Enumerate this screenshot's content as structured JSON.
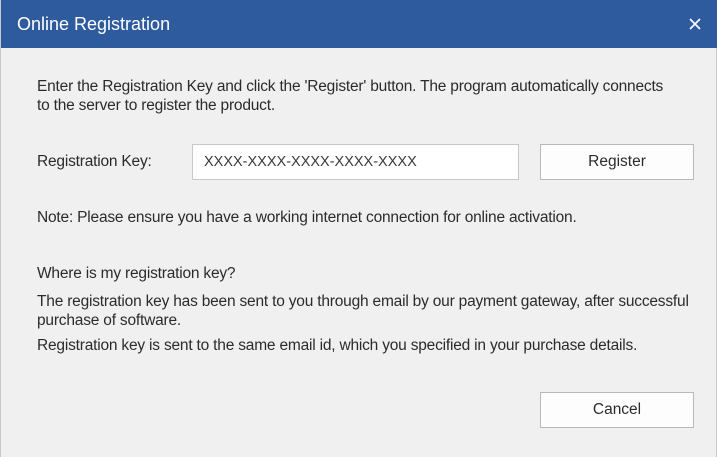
{
  "window": {
    "title": "Online Registration",
    "close_icon": "close-icon"
  },
  "content": {
    "intro": "Enter the Registration Key and click the 'Register' button. The program automatically connects to the server to register the product.",
    "registration_key_label": "Registration Key:",
    "registration_key_value": "XXXX-XXXX-XXXX-XXXX-XXXX",
    "register_button": "Register",
    "note": "Note: Please ensure you have a working internet connection for online activation.",
    "where_heading": "Where is my registration key?",
    "sent_info": "The registration key has been sent to you through email by our payment gateway, after successful purchase of software.",
    "same_email_info": "Registration key is sent to the same email id, which you specified in your purchase details.",
    "cancel_button": "Cancel"
  },
  "colors": {
    "titlebar": "#2e5a9e",
    "background": "#f0f0f0"
  }
}
